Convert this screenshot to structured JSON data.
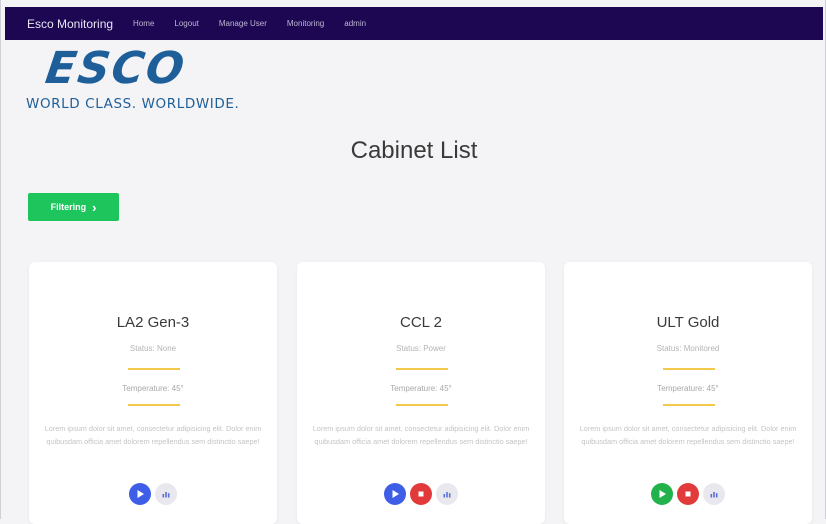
{
  "navbar": {
    "brand": "Esco Monitoring",
    "links": [
      "Home",
      "Logout",
      "Manage User",
      "Monitoring",
      "admin"
    ]
  },
  "logo": {
    "mark": "ESCO",
    "tagline": "WORLD CLASS. WORLDWIDE."
  },
  "page": {
    "title": "Cabinet List",
    "filter_label": "Filtering"
  },
  "cards": [
    {
      "title": "LA2 Gen-3",
      "status": "Status: None",
      "temperature": "Temperature: 45°",
      "description": "Lorem ipsum dolor sit amet, consectetur adipisicing elit. Dolor enim quibusdam officia amet dolorem repellendus sem distinctio saepe!",
      "actions": [
        "play",
        "chart"
      ]
    },
    {
      "title": "CCL 2",
      "status": "Status: Power",
      "temperature": "Temperature: 45°",
      "description": "Lorem ipsum dolor sit amet, consectetur adipisicing elit. Dolor enim quibusdam officia amet dolorem repellendus sem distinctio saepe!",
      "actions": [
        "play",
        "stop",
        "chart"
      ]
    },
    {
      "title": "ULT Gold",
      "status": "Status: Monitored",
      "temperature": "Temperature: 45°",
      "description": "Lorem ipsum dolor sit amet, consectetur adipisicing elit. Dolor enim quibusdam officia amet dolorem repellendus sem distinctio saepe!",
      "actions": [
        "go",
        "stop",
        "chart"
      ]
    }
  ],
  "colors": {
    "navbar": "#1d0652",
    "logo": "#1f5f99",
    "filter_button": "#1ec45c",
    "divider": "#f2c94c",
    "play": "#3f5ee8",
    "stop": "#e23a3a",
    "go": "#22b24c",
    "chart": "#e8e8ee"
  }
}
